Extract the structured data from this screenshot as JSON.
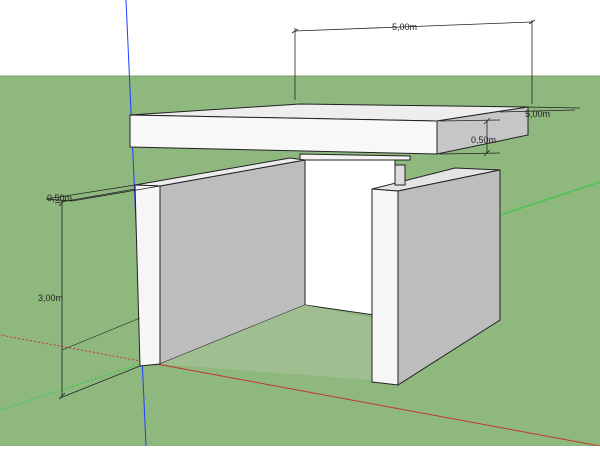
{
  "scene": {
    "sky_color": "#ffffff",
    "ground_color": "#8fb87f",
    "axes": {
      "red": "#c0392b",
      "green": "#2ecc40",
      "blue": "#1f3cff"
    }
  },
  "dimensions": {
    "slab_width": "5,00m",
    "slab_depth": "5,00m",
    "slab_thickness": "0,50m",
    "wall_thickness": "0,50m",
    "wall_height": "3,00m"
  }
}
